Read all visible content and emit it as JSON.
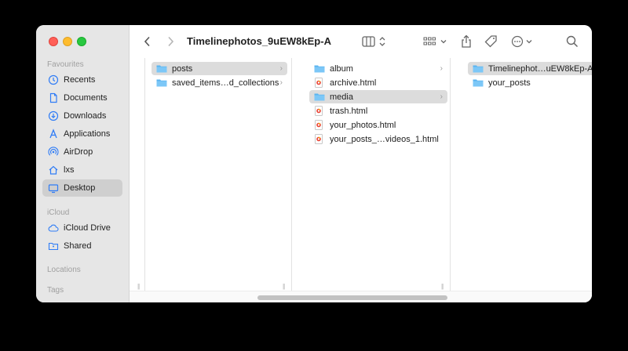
{
  "window": {
    "title": "Timelinephotos_9uEW8kEp-A"
  },
  "sidebar": {
    "sections": [
      {
        "label": "Favourites",
        "items": [
          {
            "label": "Recents",
            "icon": "clock-icon"
          },
          {
            "label": "Documents",
            "icon": "document-icon"
          },
          {
            "label": "Downloads",
            "icon": "download-icon"
          },
          {
            "label": "Applications",
            "icon": "applications-icon"
          },
          {
            "label": "AirDrop",
            "icon": "airdrop-icon"
          },
          {
            "label": "lxs",
            "icon": "home-icon"
          },
          {
            "label": "Desktop",
            "icon": "desktop-icon",
            "selected": true
          }
        ]
      },
      {
        "label": "iCloud",
        "items": [
          {
            "label": "iCloud Drive",
            "icon": "cloud-icon"
          },
          {
            "label": "Shared",
            "icon": "shared-folder-icon"
          }
        ]
      },
      {
        "label": "Locations",
        "items": []
      },
      {
        "label": "Tags",
        "items": []
      }
    ]
  },
  "columns": [
    {
      "items": [
        {
          "name": "posts",
          "type": "folder",
          "selected": true
        },
        {
          "name": "saved_items…d_collections",
          "type": "folder"
        }
      ]
    },
    {
      "items": [
        {
          "name": "album",
          "type": "folder"
        },
        {
          "name": "archive.html",
          "type": "html"
        },
        {
          "name": "media",
          "type": "folder",
          "selected": true
        },
        {
          "name": "trash.html",
          "type": "html"
        },
        {
          "name": "your_photos.html",
          "type": "html"
        },
        {
          "name": "your_posts_…videos_1.html",
          "type": "html"
        }
      ]
    },
    {
      "items": [
        {
          "name": "Timelinephot…uEW8kEp-A",
          "type": "folder",
          "selected": true
        },
        {
          "name": "your_posts",
          "type": "folder"
        }
      ]
    }
  ],
  "colors": {
    "folder": "#5ab4f0",
    "selection": "#dcdcdc",
    "sidebar_selection": "#cfcfcf"
  }
}
